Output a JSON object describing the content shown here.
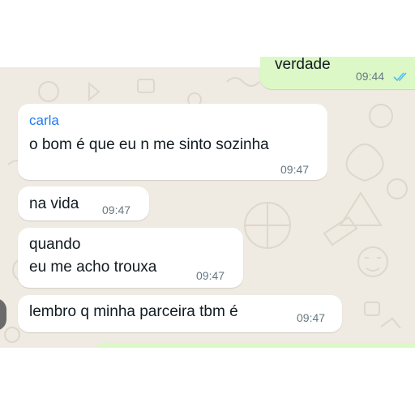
{
  "colors": {
    "chat_background": "#efeae2",
    "incoming_bubble": "#ffffff",
    "outgoing_bubble": "#dcf8c6",
    "sender_name": "#1f7aec",
    "read_ticks": "#53bdeb",
    "timestamp": "#667781"
  },
  "messages": [
    {
      "direction": "outgoing",
      "text": "verdade",
      "time": "09:44",
      "status": "read",
      "status_icon": "double-check-icon"
    },
    {
      "direction": "incoming",
      "sender": "carla",
      "text": "o bom é que eu n me sinto sozinha",
      "time": "09:47"
    },
    {
      "direction": "incoming",
      "text": "na vida",
      "time": "09:47"
    },
    {
      "direction": "incoming",
      "lines": [
        "quando",
        "eu me acho trouxa"
      ],
      "time": "09:47"
    },
    {
      "direction": "incoming",
      "text": "lembro q minha parceira tbm é",
      "time": "09:47"
    }
  ]
}
